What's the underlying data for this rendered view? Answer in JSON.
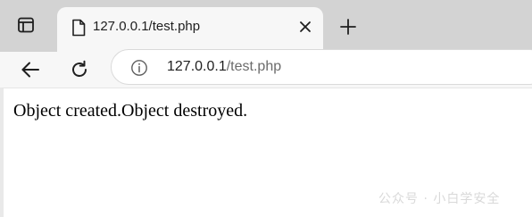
{
  "tab": {
    "title": "127.0.0.1/test.php"
  },
  "address_bar": {
    "host": "127.0.0.1",
    "path": "/test.php"
  },
  "page": {
    "text": "Object created.Object destroyed."
  },
  "watermark": {
    "text": "公众号 · 小白学安全"
  },
  "icons": {
    "tab_actions": "tab-actions-icon",
    "favicon": "page-document-icon",
    "close": "close-icon",
    "new_tab": "plus-icon",
    "back": "back-arrow-icon",
    "reload": "reload-icon",
    "site_info": "info-icon"
  },
  "colors": {
    "tabstrip": "#d3d3d3",
    "toolbar": "#f7f7f7",
    "url_path": "#6b6b6b"
  }
}
